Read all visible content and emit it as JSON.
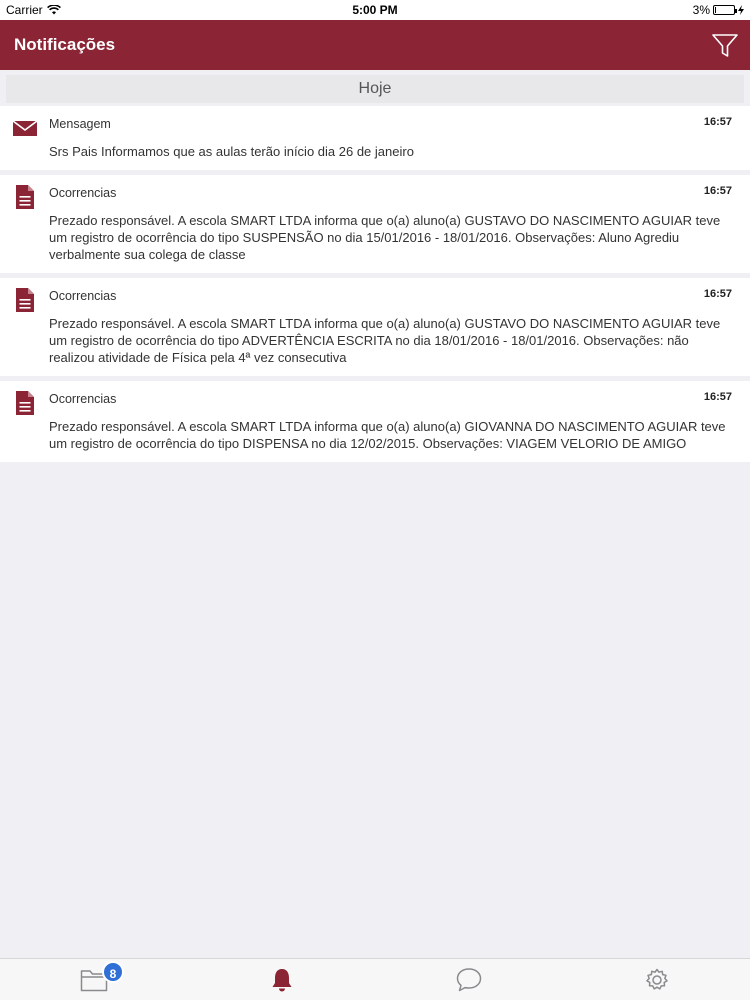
{
  "status_bar": {
    "carrier": "Carrier",
    "time": "5:00 PM",
    "battery": "3%",
    "battery_level": 0.03
  },
  "nav": {
    "title": "Notificações"
  },
  "section": {
    "label": "Hoje"
  },
  "notifications": [
    {
      "type": "Mensagem",
      "time": "16:57",
      "icon": "envelope-icon",
      "body": "Srs Pais Informamos que as aulas terão início dia 26 de janeiro"
    },
    {
      "type": "Ocorrencias",
      "time": "16:57",
      "icon": "document-icon",
      "body": "Prezado responsável. A escola SMART LTDA informa que o(a) aluno(a) GUSTAVO DO NASCIMENTO AGUIAR teve um registro de ocorrência do tipo SUSPENSÃO no dia 15/01/2016 - 18/01/2016. Observações: Aluno Agrediu verbalmente sua colega de classe"
    },
    {
      "type": "Ocorrencias",
      "time": "16:57",
      "icon": "document-icon",
      "body": "Prezado responsável. A escola SMART LTDA informa que o(a) aluno(a) GUSTAVO DO NASCIMENTO AGUIAR teve um registro de ocorrência do tipo ADVERTÊNCIA ESCRITA no dia 18/01/2016 - 18/01/2016. Observações: não realizou atividade de Física pela 4ª vez consecutiva"
    },
    {
      "type": "Ocorrencias",
      "time": "16:57",
      "icon": "document-icon",
      "body": "Prezado responsável. A escola SMART LTDA informa que o(a) aluno(a) GIOVANNA DO NASCIMENTO AGUIAR teve um registro de ocorrência do tipo DISPENSA no dia 12/02/2015. Observações: VIAGEM VELORIO DE AMIGO"
    }
  ],
  "tabs": [
    {
      "icon": "folder-icon",
      "badge": "8"
    },
    {
      "icon": "bell-icon",
      "active": true
    },
    {
      "icon": "chat-bubble-icon"
    },
    {
      "icon": "gear-icon"
    }
  ],
  "colors": {
    "brand": "#8b2535",
    "badge": "#2f6fd6",
    "background": "#efeff4"
  }
}
